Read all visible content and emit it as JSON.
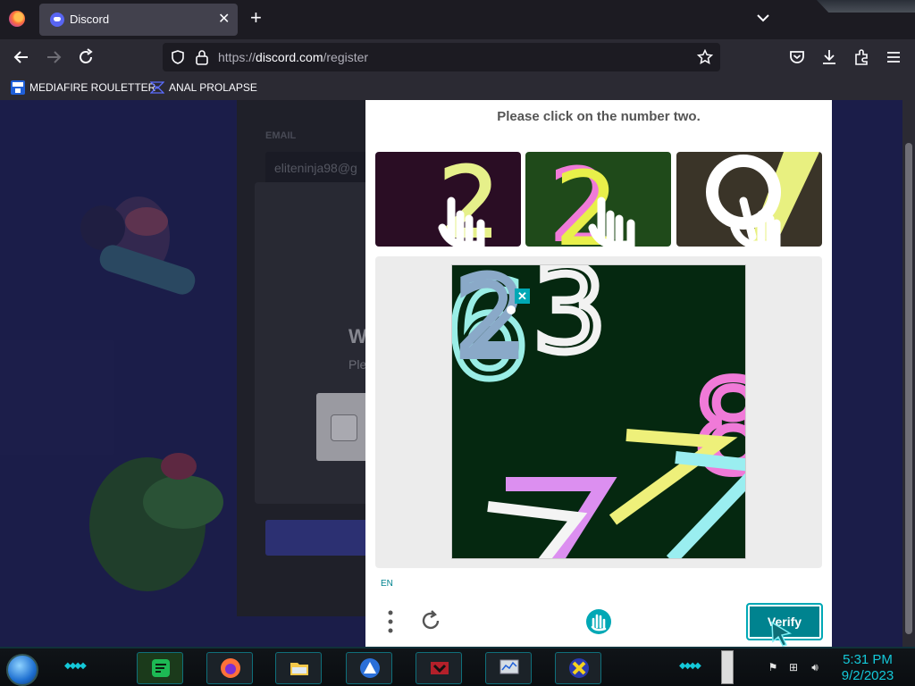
{
  "browser": {
    "tab": {
      "title": "Discord",
      "close_glyph": "✕"
    },
    "new_tab_glyph": "+",
    "url": {
      "prefix": "https://",
      "host": "discord.com",
      "path": "/register"
    },
    "bookmarks": [
      {
        "label": "MEDIAFIRE ROULETTER",
        "icon": "mediafire-icon"
      },
      {
        "label": "ANAL PROLAPSE",
        "icon": "bookmark-icon"
      }
    ]
  },
  "page": {
    "email_label": "EMAIL",
    "email_value": "eliteninja98@g",
    "modal_title": "W",
    "modal_sub": "Ple"
  },
  "captcha": {
    "prompt": "Please click on the number two.",
    "language": "EN",
    "verify_label": "Verify",
    "selected_mark": "✕",
    "accent": "#00838f"
  },
  "taskbar": {
    "time": "5:31 PM",
    "date": "9/2/2023",
    "accent": "#14c8d8"
  }
}
